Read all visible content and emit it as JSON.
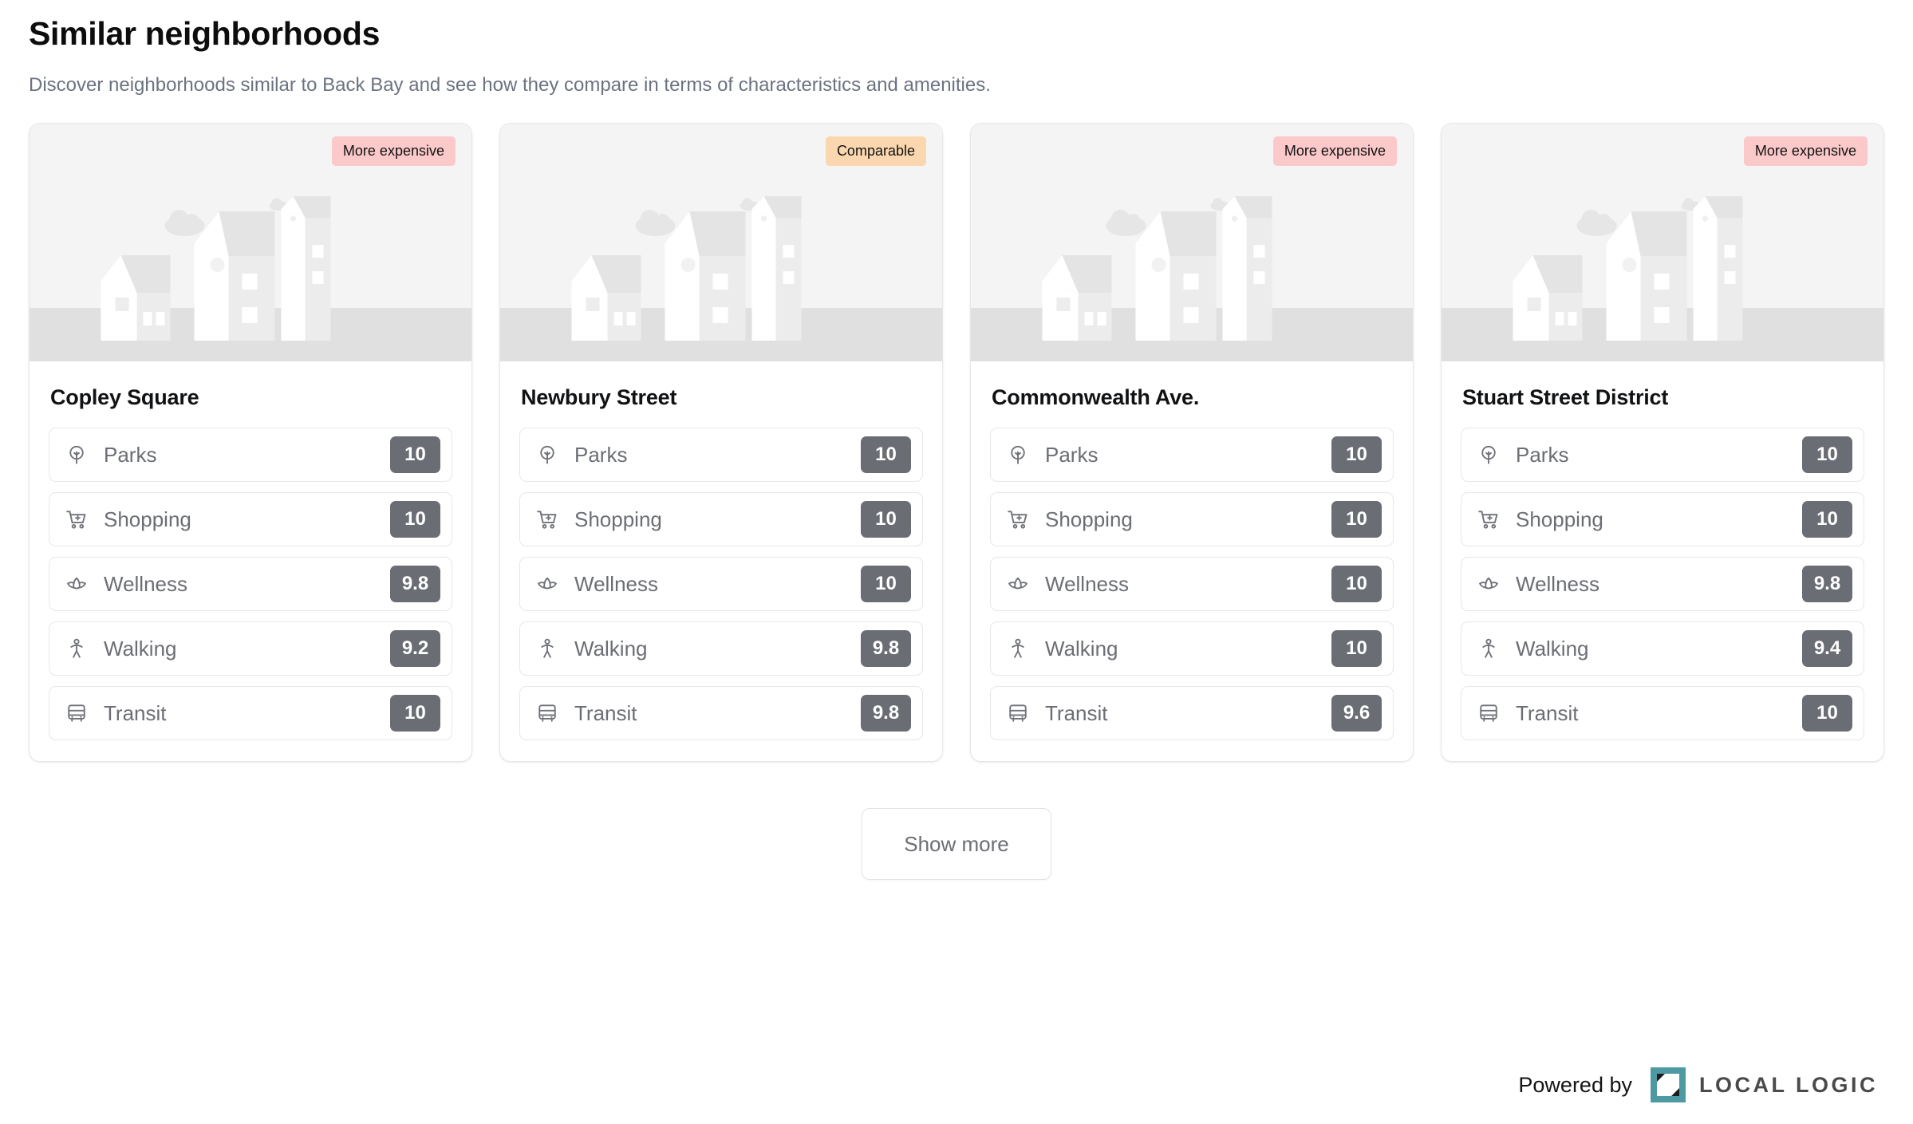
{
  "header": {
    "title": "Similar neighborhoods",
    "subtitle": "Discover neighborhoods similar to Back Bay and see how they compare in terms of characteristics and amenities."
  },
  "colors": {
    "badge_expensive_bg": "#fbc9c9",
    "badge_comparable_bg": "#fad7ae",
    "score_chip_bg": "#6b6d75",
    "logo_teal": "#4e9aa3",
    "subtitle_gray": "#6b7280",
    "label_gray": "#6b6e74"
  },
  "cards": [
    {
      "title": "Copley Square",
      "badge": {
        "label": "More expensive",
        "kind": "expensive"
      },
      "metrics": [
        {
          "icon": "parks-icon",
          "label": "Parks",
          "score": "10"
        },
        {
          "icon": "shopping-icon",
          "label": "Shopping",
          "score": "10"
        },
        {
          "icon": "wellness-icon",
          "label": "Wellness",
          "score": "9.8"
        },
        {
          "icon": "walking-icon",
          "label": "Walking",
          "score": "9.2"
        },
        {
          "icon": "transit-icon",
          "label": "Transit",
          "score": "10"
        }
      ]
    },
    {
      "title": "Newbury Street",
      "badge": {
        "label": "Comparable",
        "kind": "comparable"
      },
      "metrics": [
        {
          "icon": "parks-icon",
          "label": "Parks",
          "score": "10"
        },
        {
          "icon": "shopping-icon",
          "label": "Shopping",
          "score": "10"
        },
        {
          "icon": "wellness-icon",
          "label": "Wellness",
          "score": "10"
        },
        {
          "icon": "walking-icon",
          "label": "Walking",
          "score": "9.8"
        },
        {
          "icon": "transit-icon",
          "label": "Transit",
          "score": "9.8"
        }
      ]
    },
    {
      "title": "Commonwealth Ave.",
      "badge": {
        "label": "More expensive",
        "kind": "expensive"
      },
      "metrics": [
        {
          "icon": "parks-icon",
          "label": "Parks",
          "score": "10"
        },
        {
          "icon": "shopping-icon",
          "label": "Shopping",
          "score": "10"
        },
        {
          "icon": "wellness-icon",
          "label": "Wellness",
          "score": "10"
        },
        {
          "icon": "walking-icon",
          "label": "Walking",
          "score": "10"
        },
        {
          "icon": "transit-icon",
          "label": "Transit",
          "score": "9.6"
        }
      ]
    },
    {
      "title": "Stuart Street District",
      "badge": {
        "label": "More expensive",
        "kind": "expensive"
      },
      "metrics": [
        {
          "icon": "parks-icon",
          "label": "Parks",
          "score": "10"
        },
        {
          "icon": "shopping-icon",
          "label": "Shopping",
          "score": "10"
        },
        {
          "icon": "wellness-icon",
          "label": "Wellness",
          "score": "9.8"
        },
        {
          "icon": "walking-icon",
          "label": "Walking",
          "score": "9.4"
        },
        {
          "icon": "transit-icon",
          "label": "Transit",
          "score": "10"
        }
      ]
    }
  ],
  "show_more": {
    "label": "Show more"
  },
  "footer": {
    "powered_by": "Powered by",
    "brand": "LOCAL LOGIC"
  }
}
